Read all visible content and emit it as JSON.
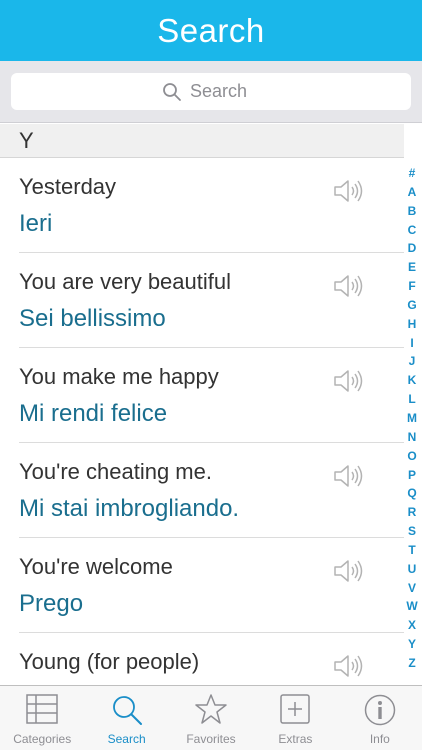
{
  "header": {
    "title": "Search"
  },
  "search": {
    "placeholder": "Search"
  },
  "section": {
    "letter": "Y"
  },
  "phrases": [
    {
      "english": "Yesterday",
      "italian": "Ieri"
    },
    {
      "english": "You are very beautiful",
      "italian": "Sei bellissimo"
    },
    {
      "english": "You make me happy",
      "italian": "Mi rendi felice"
    },
    {
      "english": "You're cheating me.",
      "italian": "Mi stai imbrogliando."
    },
    {
      "english": "You're welcome",
      "italian": "Prego"
    },
    {
      "english": "Young (for people)",
      "italian": ""
    }
  ],
  "index": [
    "#",
    "A",
    "B",
    "C",
    "D",
    "E",
    "F",
    "G",
    "H",
    "I",
    "J",
    "K",
    "L",
    "M",
    "N",
    "O",
    "P",
    "Q",
    "R",
    "S",
    "T",
    "U",
    "V",
    "W",
    "X",
    "Y",
    "Z"
  ],
  "tabs": [
    {
      "label": "Categories",
      "icon": "list-icon"
    },
    {
      "label": "Search",
      "icon": "search-icon"
    },
    {
      "label": "Favorites",
      "icon": "star-icon"
    },
    {
      "label": "Extras",
      "icon": "plus-icon"
    },
    {
      "label": "Info",
      "icon": "info-icon"
    }
  ],
  "colors": {
    "header": "#1ab7ea",
    "accent": "#1a8ec8",
    "italian_text": "#1a6e8e"
  }
}
